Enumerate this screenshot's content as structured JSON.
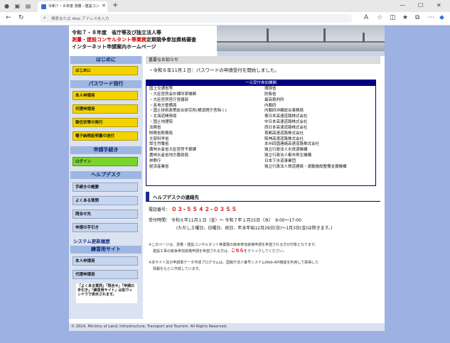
{
  "browser": {
    "tab_title": "令和７・８年度 測量・建設コンサル",
    "address_placeholder": "検索または Web アドレスを入力"
  },
  "header": {
    "line1": "令和７・８年度　省庁等及び独立法人等",
    "line2_red": "測量・建設コンサルタント等業務",
    "line2_black": "定期競争参加資格審査",
    "line3": "インターネット申請案内ホームページ"
  },
  "sidebar": {
    "sec_intro": "はじめに",
    "btn_intro": "はじめに",
    "sec_password": "パスワード発行",
    "btn_main": "本人申請用",
    "btn_agent": "代理申請用",
    "btn_delegate": "委任状等の発行",
    "btn_cert": "電子納税証明書の送付",
    "sec_apply": "申請手続き",
    "btn_login": "ログイン",
    "sec_help": "ヘルプデスク",
    "btn_overview": "手続きの概要",
    "btn_faq": "よくある質問",
    "btn_contact": "問合せ先",
    "btn_guide": "申請の手引き",
    "link_history": "システム更新履歴",
    "sec_practice": "練習用サイト",
    "btn_practice_main": "本人申請用",
    "btn_practice_agent": "代理申請用",
    "note": "「よくある質問」「問合せ」「申請の手引き」「練習用サイト」は別ウィンドウで表示されます。"
  },
  "main": {
    "important_title": "重要なお知らせ",
    "notice": "・令和６年11月１日：パスワードの申請受付を開始しました。",
    "table_header": "一元受付参加機関",
    "col_left": [
      "国土交通省等",
      "・大臣官房会計課所掌機関",
      "・大臣官房官庁営繕部",
      "・各地方整備局",
      "・国土技術政策総合研究所(横須賀庁舎除く)",
      "・北海道開発局",
      "・国土地理院",
      "法務省",
      "財務省財務局",
      "文部科学省",
      "厚生労働省",
      "農林水産省大臣官房予算課",
      "農林水産省地方農政局",
      "林野庁",
      "経済産業省"
    ],
    "col_right": [
      "環境省",
      "防衛省",
      "最高裁判所",
      "内閣府",
      "内閣府沖縄総合事務局",
      "東日本高速道路株式会社",
      "中日本高速道路株式会社",
      "西日本高速道路株式会社",
      "首都高速道路株式会社",
      "阪神高速道路株式会社",
      "本州四国連絡高速道路株式会社",
      "独立行政法人水資源機構",
      "独立行政法人都市再生機構",
      "日本下水道事業団",
      "独立行政法人鉄道建設・運輸施設整備支援機構"
    ],
    "helpdesk_title": "ヘルプデスクの連絡先",
    "phone_label": "電話番号：",
    "phone": "０３-５５４２-０３５５",
    "hours_label": "受付時間：",
    "hours": "令和６年11月１日（金）～ 令和７年１月15日（水）　9:00～17:00",
    "hours_note": "(ただし土曜日、日曜日、祝日、年末年始12月29日(日)～1月3日(金)は除きます。)",
    "remark1_a": "※このページは、測量・建設コンサルタント等業務の競争参加資格申請を希望される方が対象となります。",
    "remark1_b": "建設工事の競争参加資格申請を希望される方は、",
    "remark1_link": "こちら",
    "remark1_c": "をクリックしてください。",
    "remark2_a": "※本サイト及び申請書データ作成プログラムは、国税庁法人番号システムWeb-API機能を利用して取得した",
    "remark2_b": "情報をもとに作成しています。"
  },
  "footer": "© 2024, Ministry of Land, Infrastructure, Transport and Tourism. All Rights Reserved."
}
